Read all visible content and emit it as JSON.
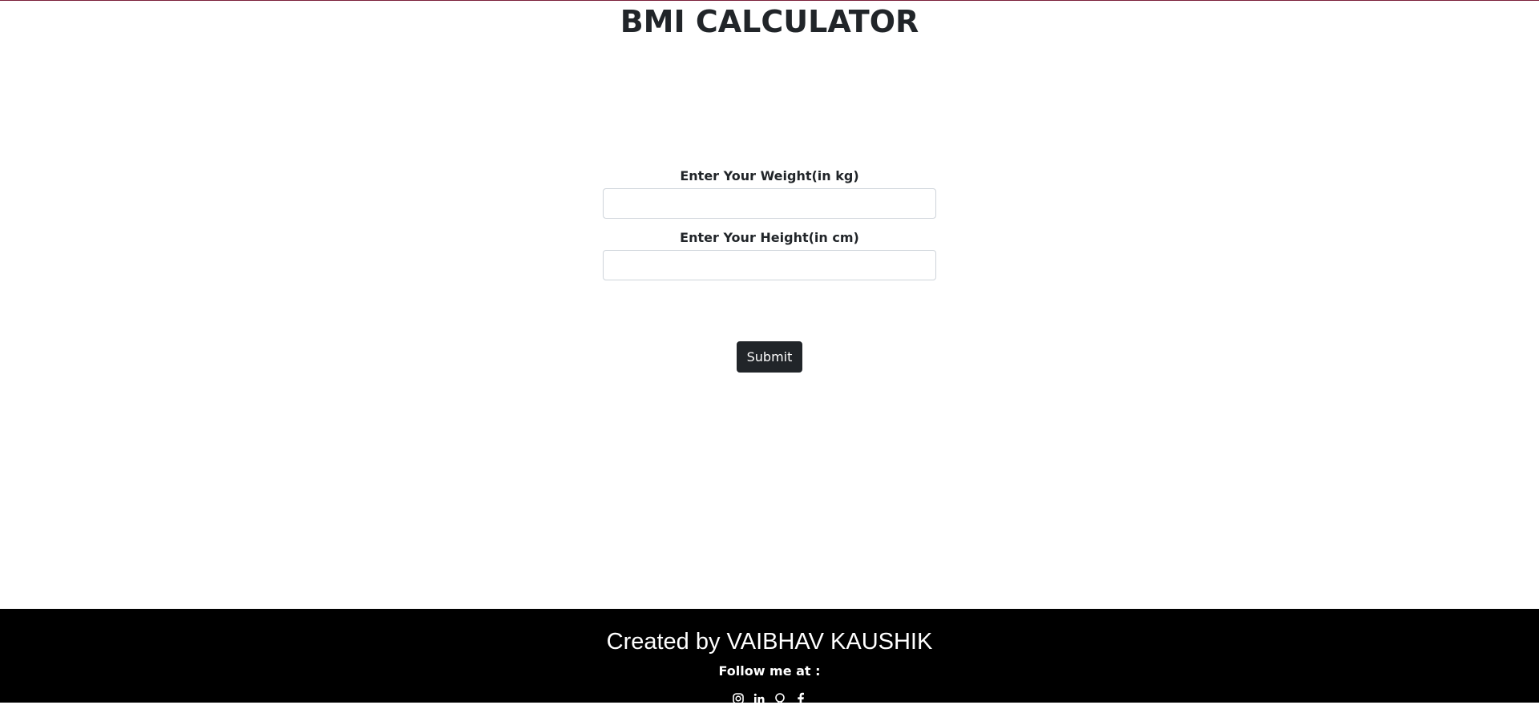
{
  "header": {
    "title": "BMI CALCULATOR"
  },
  "form": {
    "weight_label": "Enter Your Weight(in kg)",
    "weight_value": "",
    "height_label": "Enter Your Height(in cm)",
    "height_value": "",
    "submit_label": "Submit"
  },
  "footer": {
    "credit": "Created by VAIBHAV KAUSHIK",
    "follow_label": "Follow me at :",
    "social_icons": [
      "instagram-icon",
      "linkedin-icon",
      "github-icon",
      "facebook-icon"
    ]
  },
  "colors": {
    "top_line": "#7a1f3a",
    "button_bg": "#212529",
    "footer_bg": "#000000"
  }
}
